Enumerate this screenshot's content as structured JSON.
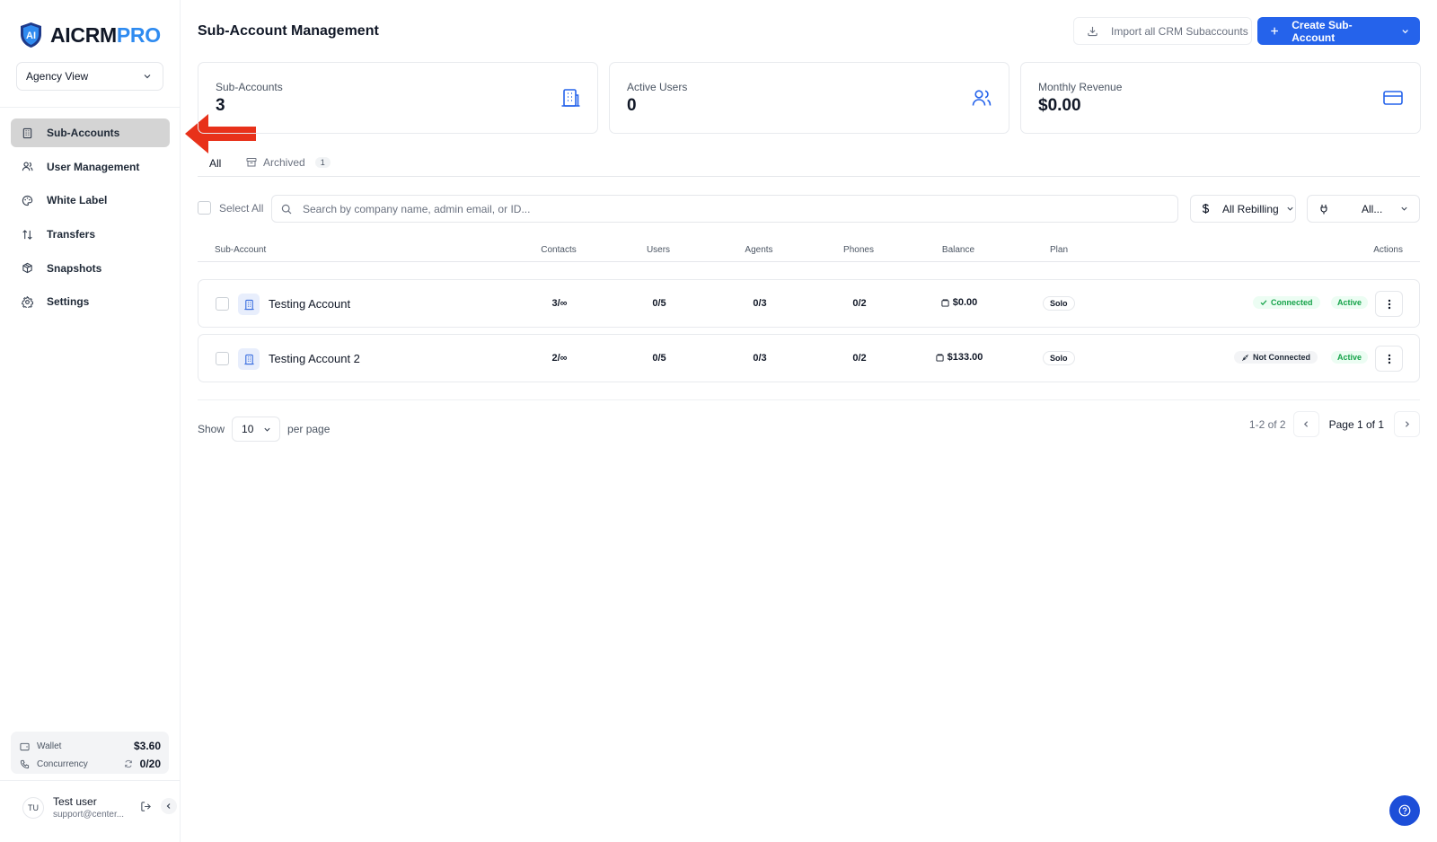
{
  "brand": {
    "name_main": "AICRM",
    "name_accent": "PRO"
  },
  "view_selector": {
    "value": "Agency View"
  },
  "sidebar": {
    "items": [
      {
        "label": "Sub-Accounts",
        "icon": "building-icon",
        "active": true
      },
      {
        "label": "User Management",
        "icon": "users-icon"
      },
      {
        "label": "White Label",
        "icon": "palette-icon"
      },
      {
        "label": "Transfers",
        "icon": "arrows-icon"
      },
      {
        "label": "Snapshots",
        "icon": "box-icon"
      },
      {
        "label": "Settings",
        "icon": "gear-icon"
      }
    ],
    "wallet_label": "Wallet",
    "wallet_value": "$3.60",
    "concurrency_label": "Concurrency",
    "concurrency_value": "0/20",
    "user_initials": "TU",
    "user_name": "Test user",
    "user_email": "support@center..."
  },
  "header": {
    "title": "Sub-Account Management",
    "import_label": "Import all CRM Subaccounts",
    "create_label": "Create Sub-Account"
  },
  "stats": [
    {
      "label": "Sub-Accounts",
      "value": "3",
      "icon": "building-icon"
    },
    {
      "label": "Active Users",
      "value": "0",
      "icon": "users-icon"
    },
    {
      "label": "Monthly Revenue",
      "value": "$0.00",
      "icon": "credit-card-icon"
    }
  ],
  "tabs": {
    "all": "All",
    "archived": "Archived",
    "archived_count": "1"
  },
  "filters": {
    "select_all": "Select All",
    "search_placeholder": "Search by company name, admin email, or ID...",
    "rebilling": "All Rebilling",
    "connection": "All..."
  },
  "table": {
    "columns": {
      "subaccount": "Sub-Account",
      "contacts": "Contacts",
      "users": "Users",
      "agents": "Agents",
      "phones": "Phones",
      "balance": "Balance",
      "plan": "Plan",
      "actions": "Actions"
    },
    "rows": [
      {
        "name": "Testing Account",
        "contacts": "3/∞",
        "users": "0/5",
        "agents": "0/3",
        "phones": "0/2",
        "balance": "$0.00",
        "plan": "Solo",
        "connection": "Connected",
        "status": "Active"
      },
      {
        "name": "Testing Account 2",
        "contacts": "2/∞",
        "users": "0/5",
        "agents": "0/3",
        "phones": "0/2",
        "balance": "$133.00",
        "plan": "Solo",
        "connection": "Not Connected",
        "status": "Active"
      }
    ]
  },
  "pagination": {
    "show_label": "Show",
    "per_page_value": "10",
    "per_page_label": "per page",
    "range": "1-2 of 2",
    "page_info": "Page 1 of 1"
  },
  "colors": {
    "primary": "#2563eb",
    "accent": "#2f8bf0",
    "success": "#16a34a",
    "annotation_arrow": "#e8311a"
  }
}
